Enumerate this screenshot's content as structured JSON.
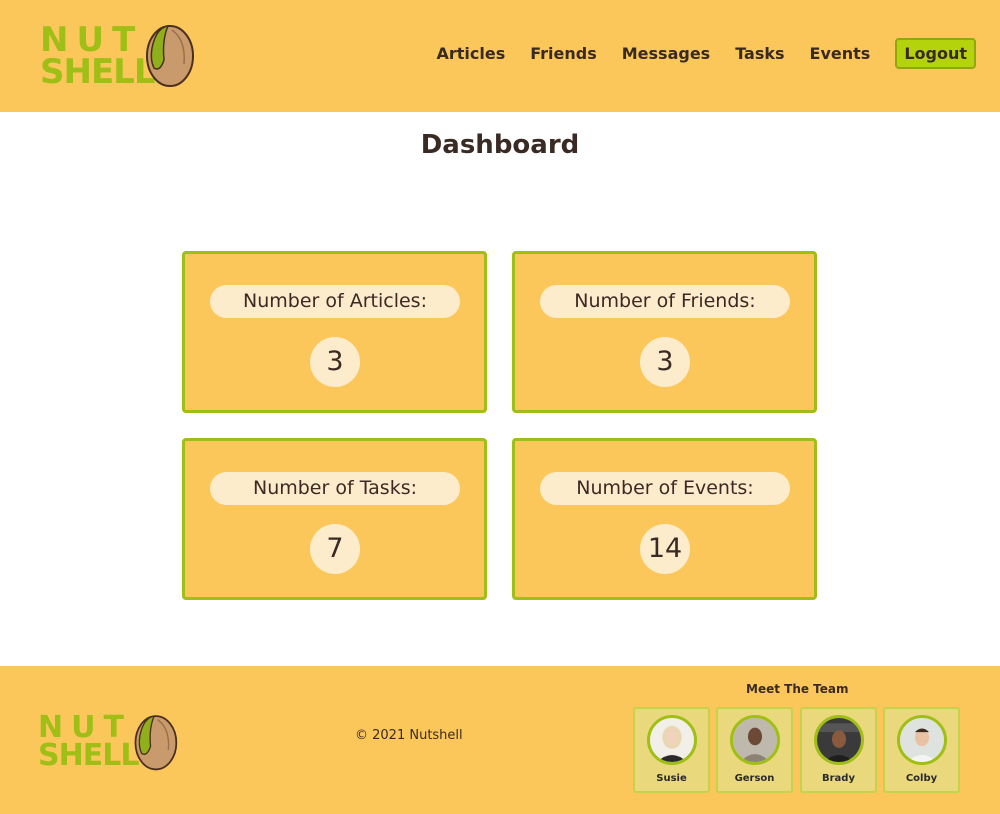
{
  "brand": {
    "logo_line1": "NUT",
    "logo_line2": "SHELL"
  },
  "nav": {
    "items": [
      {
        "label": "Articles"
      },
      {
        "label": "Friends"
      },
      {
        "label": "Messages"
      },
      {
        "label": "Tasks"
      },
      {
        "label": "Events"
      }
    ],
    "logout_label": "Logout"
  },
  "main": {
    "title": "Dashboard",
    "cards": {
      "articles": {
        "label": "Number of Articles:",
        "count": "3"
      },
      "friends": {
        "label": "Number of Friends:",
        "count": "3"
      },
      "tasks": {
        "label": "Number of Tasks:",
        "count": "7"
      },
      "events": {
        "label": "Number of Events:",
        "count": "14"
      }
    }
  },
  "footer": {
    "copyright": "© 2021 Nutshell",
    "team_title": "Meet The Team",
    "team": [
      {
        "name": "Susie"
      },
      {
        "name": "Gerson"
      },
      {
        "name": "Brady"
      },
      {
        "name": "Colby"
      }
    ]
  },
  "colors": {
    "header_bg": "#fcc75a",
    "accent_green": "#9fbe16",
    "pill_bg": "#fdeccb",
    "text_dark": "#3a2a24"
  }
}
